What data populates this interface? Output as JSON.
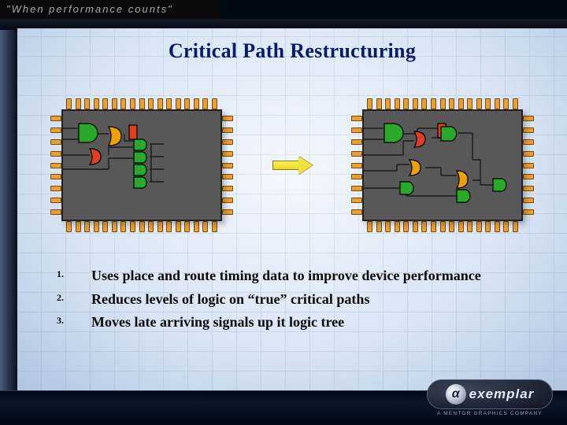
{
  "tagline": "\"When performance counts\"",
  "title": "Critical Path Restructuring",
  "bullets": [
    "Uses place and route timing data to improve device performance",
    "Reduces levels of logic on “true” critical paths",
    "Moves late arriving signals up it logic tree"
  ],
  "logo": {
    "glyph": "α",
    "text": "exemplar",
    "subtitle": "A MENTOR GRAPHICS COMPANY"
  },
  "diagram": {
    "left_desc": "chip-before",
    "right_desc": "chip-after",
    "arrow_desc": "transform-arrow",
    "gate_colors": {
      "buf": "#2aa82a",
      "and": "#e04020",
      "or": "#f0a000"
    }
  }
}
